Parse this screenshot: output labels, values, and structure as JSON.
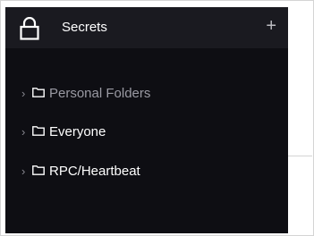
{
  "sidebar": {
    "header": {
      "title": "Secrets",
      "add_label": "+"
    },
    "folders": [
      {
        "label": "Personal Folders",
        "muted": true
      },
      {
        "label": "Everyone",
        "muted": false
      },
      {
        "label": "RPC/Heartbeat",
        "muted": false
      }
    ],
    "chevron": "›"
  }
}
